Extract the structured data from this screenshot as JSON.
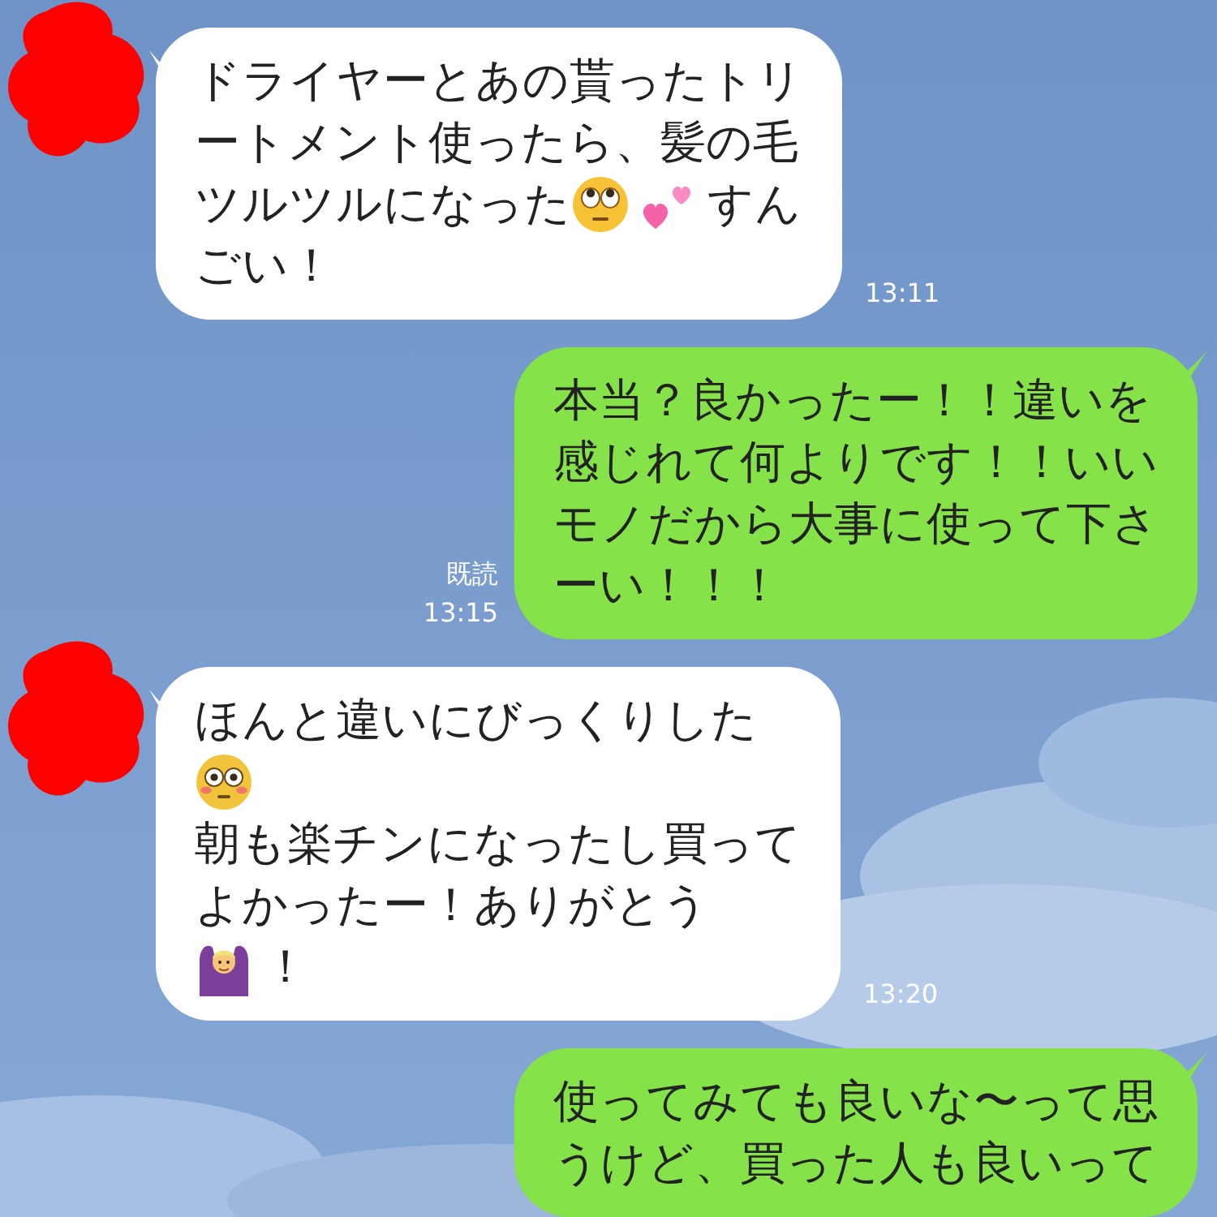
{
  "messages": [
    {
      "kind": "incoming",
      "avatar_hidden": true,
      "time": "13:11",
      "lines": [
        [
          {
            "kind": "text",
            "text": "ドライヤーとあの貰ったトリ"
          }
        ],
        [
          {
            "kind": "text",
            "text": "ートメント使ったら、髪の毛"
          }
        ],
        [
          {
            "kind": "text",
            "text": "ツルツルになった"
          },
          {
            "kind": "eyeroll"
          },
          {
            "kind": "hearts"
          },
          {
            "kind": "text",
            "text": "すん"
          }
        ],
        [
          {
            "kind": "text",
            "text": "ごい！"
          }
        ]
      ]
    },
    {
      "kind": "outgoing",
      "read": "既読",
      "time": "13:15",
      "lines": [
        [
          {
            "kind": "text",
            "text": "本当？良かったー！！違いを"
          }
        ],
        [
          {
            "kind": "text",
            "text": "感じれて何よりです！！いい"
          }
        ],
        [
          {
            "kind": "text",
            "text": "モノだから大事に使って下さ"
          }
        ],
        [
          {
            "kind": "text",
            "text": "ーい！！！"
          }
        ]
      ]
    },
    {
      "kind": "incoming",
      "avatar_hidden": true,
      "time": "13:20",
      "lines": [
        [
          {
            "kind": "text",
            "text": "ほんと違いにびっくりした"
          }
        ],
        [
          {
            "kind": "flushed"
          }
        ],
        [
          {
            "kind": "text",
            "text": "朝も楽チンになったし買って"
          }
        ],
        [
          {
            "kind": "text",
            "text": "よかったー！ありがとう"
          }
        ],
        [
          {
            "kind": "gesture"
          },
          {
            "kind": "text",
            "text": "！"
          }
        ]
      ]
    },
    {
      "kind": "outgoing",
      "lines": [
        [
          {
            "kind": "text",
            "text": "使ってみても良いな〜って思"
          }
        ],
        [
          {
            "kind": "text",
            "text": "うけど、買った人も良いって"
          }
        ]
      ]
    }
  ]
}
